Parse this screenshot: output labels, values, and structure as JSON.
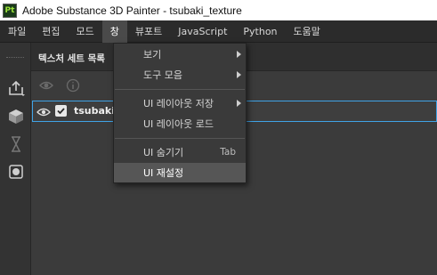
{
  "window": {
    "app_icon_text": "Pt",
    "title": "Adobe Substance 3D Painter - tsubaki_texture"
  },
  "menubar": {
    "items": [
      "파일",
      "편집",
      "모드",
      "창",
      "뷰포트",
      "JavaScript",
      "Python",
      "도움말"
    ],
    "active_index": 3
  },
  "window_menu": {
    "items": [
      {
        "label": "보기",
        "submenu": true
      },
      {
        "label": "도구 모음",
        "submenu": true
      },
      {
        "label": "UI 레이아웃 저장",
        "submenu": true
      },
      {
        "label": "UI 레이아웃 로드",
        "submenu": false
      },
      {
        "label": "UI 숨기기",
        "shortcut": "Tab",
        "submenu": false
      },
      {
        "label": "UI 재설정",
        "submenu": false,
        "hovered": true
      }
    ]
  },
  "panel": {
    "title": "텍스처 세트 목록",
    "rows": [
      {
        "label": "tsubaki",
        "visible": true,
        "checked": true,
        "selected": true
      }
    ]
  },
  "colors": {
    "selection_border": "#3fa3e6",
    "app_icon_green": "#9be23a"
  }
}
